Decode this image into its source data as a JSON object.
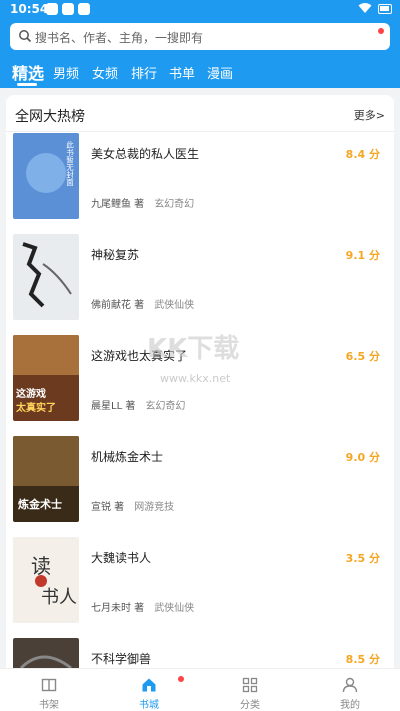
{
  "status_bar": {
    "time": "10:54"
  },
  "search": {
    "placeholder": "搜书名、作者、主角，一搜即有"
  },
  "tabs": [
    {
      "label": "精选",
      "active": true
    },
    {
      "label": "男频"
    },
    {
      "label": "女频"
    },
    {
      "label": "排行"
    },
    {
      "label": "书单"
    },
    {
      "label": "漫画"
    }
  ],
  "section": {
    "title": "全网大热榜",
    "more": "更多>"
  },
  "books": [
    {
      "title": "美女总裁的私人医生",
      "score": "8.4 分",
      "author": "九尾鲤鱼 著",
      "genre": "玄幻奇幻",
      "cover_color": "#5b8fd6",
      "cover_text": "此书暂无封面"
    },
    {
      "title": "神秘复苏",
      "score": "9.1 分",
      "author": "佛前献花 著",
      "genre": "武侠仙侠",
      "cover_color": "#e9ecef",
      "cover_text": "恐怖复苏"
    },
    {
      "title": "这游戏也太真实了",
      "score": "6.5 分",
      "author": "晨星LL 著",
      "genre": "玄幻奇幻",
      "cover_color": "#6b3a1f",
      "cover_text": "这游戏也太真实了"
    },
    {
      "title": "机械炼金术士",
      "score": "9.0 分",
      "author": "宣锐 著",
      "genre": "网游竞技",
      "cover_color": "#3a2a18",
      "cover_text": "炼金术士"
    },
    {
      "title": "大魏读书人",
      "score": "3.5 分",
      "author": "七月未时 著",
      "genre": "武侠仙侠",
      "cover_color": "#f4efe9",
      "cover_text": "读书人"
    },
    {
      "title": "不科学御兽",
      "score": "8.5 分",
      "author": "",
      "genre": "",
      "cover_color": "#4a4038",
      "cover_text": ""
    }
  ],
  "watermark": {
    "text": "KK下载",
    "url": "www.kkx.net"
  },
  "bottom_nav": [
    {
      "label": "书架",
      "icon": "bookshelf-icon"
    },
    {
      "label": "书城",
      "icon": "home-icon",
      "active": true
    },
    {
      "label": "分类",
      "icon": "grid-icon"
    },
    {
      "label": "我的",
      "icon": "user-icon"
    }
  ],
  "colors": {
    "primary": "#1e9bf0",
    "score": "#f5a623",
    "badge": "#ff4444"
  }
}
